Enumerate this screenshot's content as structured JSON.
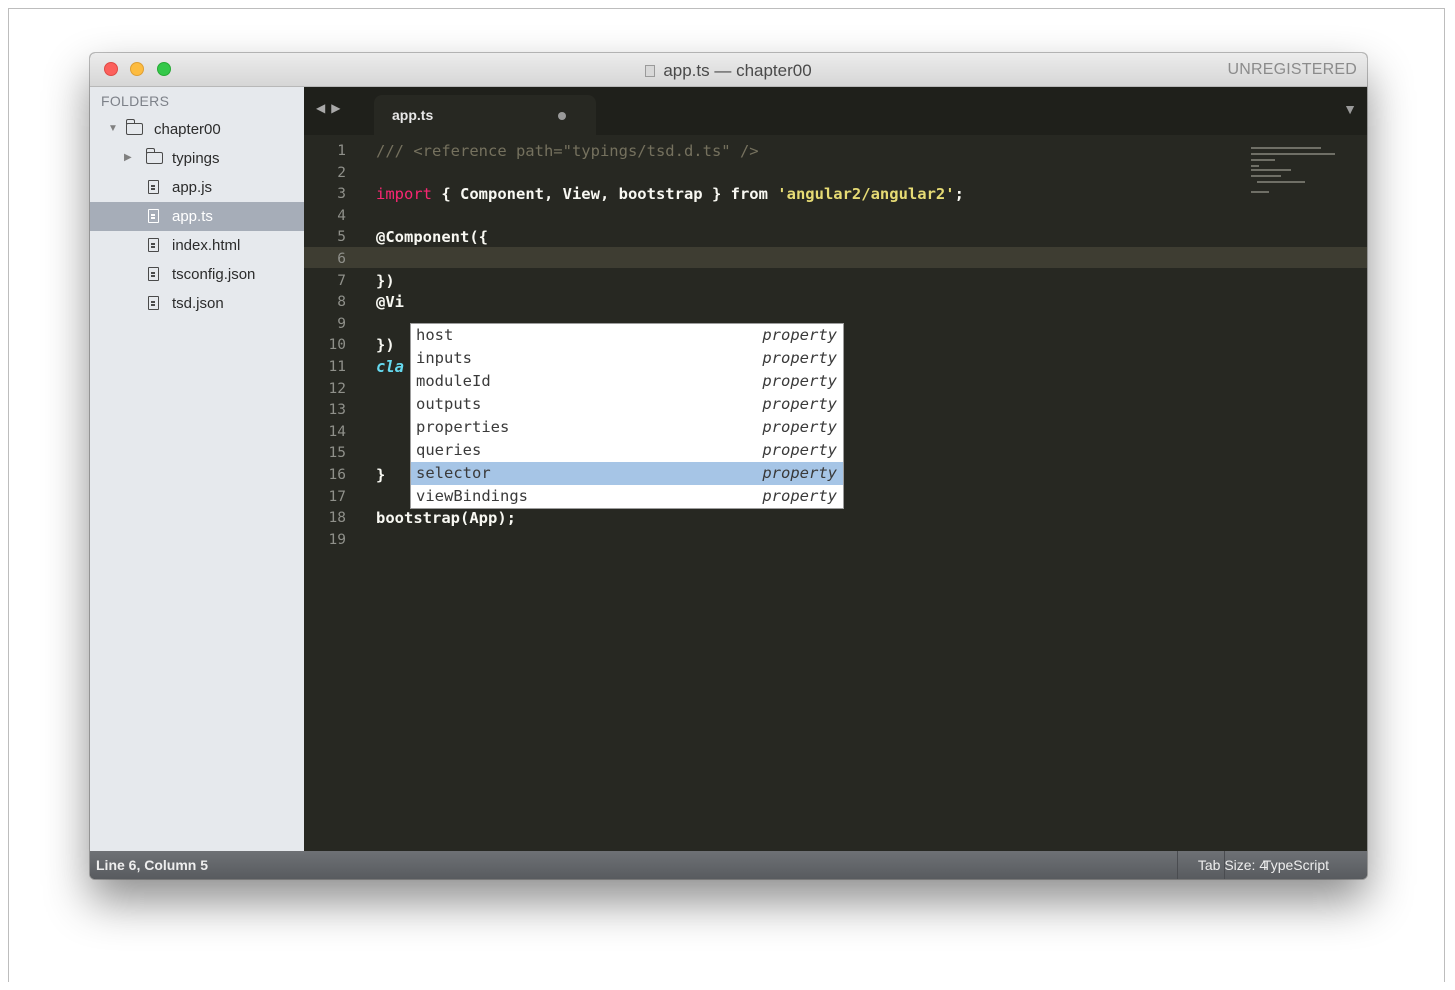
{
  "window": {
    "title": "app.ts — chapter00",
    "registration": "UNREGISTERED"
  },
  "sidebar": {
    "header": "FOLDERS",
    "items": [
      {
        "label": "chapter00",
        "type": "folder",
        "expanded": true,
        "icon": "folder-open-icon"
      },
      {
        "label": "typings",
        "type": "folder",
        "expanded": false,
        "icon": "folder-icon"
      },
      {
        "label": "app.js",
        "type": "file",
        "icon": "file-icon"
      },
      {
        "label": "app.ts",
        "type": "file",
        "icon": "file-icon",
        "selected": true
      },
      {
        "label": "index.html",
        "type": "file",
        "icon": "file-icon"
      },
      {
        "label": "tsconfig.json",
        "type": "file",
        "icon": "file-icon"
      },
      {
        "label": "tsd.json",
        "type": "file",
        "icon": "file-icon"
      }
    ]
  },
  "tabs": [
    {
      "label": "app.ts",
      "modified": true,
      "active": true
    }
  ],
  "editor": {
    "line_numbers": [
      "1",
      "2",
      "3",
      "4",
      "5",
      "6",
      "7",
      "8",
      "9",
      "10",
      "11",
      "12",
      "13",
      "14",
      "15",
      "16",
      "17",
      "18",
      "19"
    ],
    "current_line": 6,
    "lines": {
      "l1": "/// <reference path=\"typings/tsd.d.ts\" />",
      "l3_kw": "import",
      "l3_mid": " { Component, View, bootstrap } from ",
      "l3_str": "'angular2/angular2'",
      "l3_end": ";",
      "l5": "@Component({",
      "l7": "})",
      "l8": "@Vi",
      "l10": "})",
      "l11": "cla",
      "l16": "}",
      "l18": "bootstrap(App);"
    }
  },
  "autocomplete": {
    "items": [
      {
        "name": "host",
        "kind": "property"
      },
      {
        "name": "inputs",
        "kind": "property"
      },
      {
        "name": "moduleId",
        "kind": "property"
      },
      {
        "name": "outputs",
        "kind": "property"
      },
      {
        "name": "properties",
        "kind": "property"
      },
      {
        "name": "queries",
        "kind": "property"
      },
      {
        "name": "selector",
        "kind": "property",
        "selected": true
      },
      {
        "name": "viewBindings",
        "kind": "property"
      }
    ]
  },
  "statusbar": {
    "position": "Line 6, Column 5",
    "tab_size": "Tab Size: 4",
    "syntax": "TypeScript"
  },
  "colors": {
    "editor_bg": "#272822",
    "keyword": "#f92672",
    "string": "#e6db74",
    "comment": "#75715e",
    "class": "#66d9ef",
    "selection": "#a6c5e6"
  }
}
